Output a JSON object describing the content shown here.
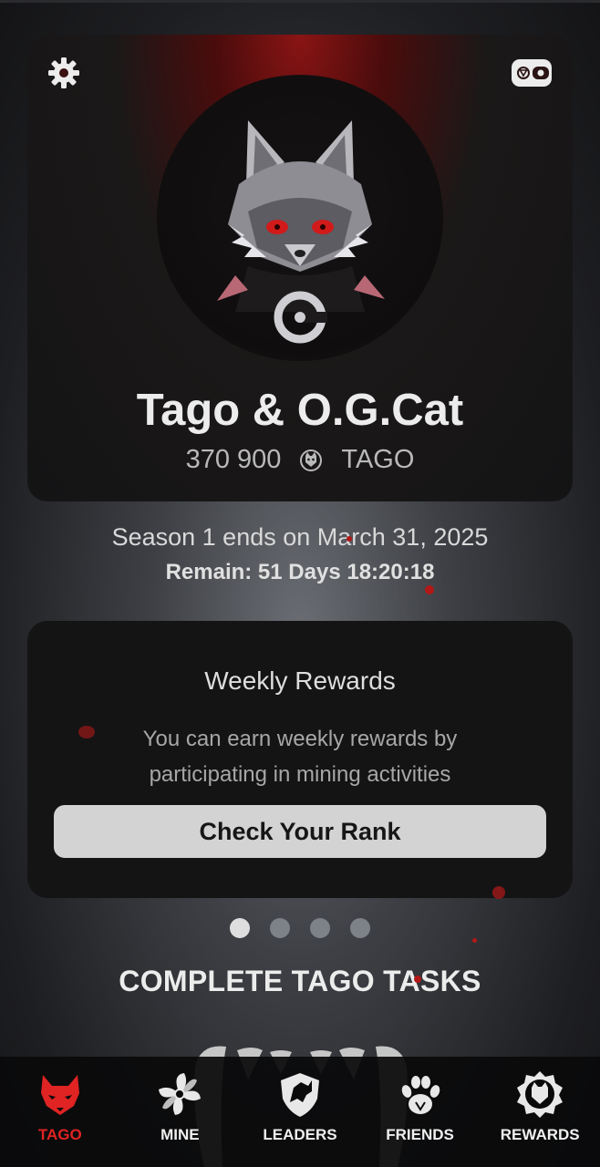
{
  "hero": {
    "title": "Tago & O.G.Cat",
    "balance": "370 900",
    "currency": "TAGO",
    "icons": [
      "gear-icon",
      "wallet-icon",
      "tago-coin-icon"
    ]
  },
  "season": {
    "ends_text": "Season 1 ends on March 31, 2025",
    "remain_text": "Remain: 51 Days 18:20:18"
  },
  "weekly": {
    "title": "Weekly Rewards",
    "description": "You can earn weekly rewards by participating in mining activities",
    "button_label": "Check Your Rank"
  },
  "carousel": {
    "pages": 4,
    "active_index": 0
  },
  "tasks_heading": "COMPLETE TAGO TASKS",
  "nav": {
    "items": [
      {
        "label": "TAGO",
        "icon": "wolf-icon",
        "active": true
      },
      {
        "label": "MINE",
        "icon": "pinwheel-icon",
        "active": false
      },
      {
        "label": "LEADERS",
        "icon": "wolf-shield-icon",
        "active": false
      },
      {
        "label": "FRIENDS",
        "icon": "paw-icon",
        "active": false
      },
      {
        "label": "REWARDS",
        "icon": "badge-icon",
        "active": false
      }
    ]
  },
  "colors": {
    "accent_red": "#e02323",
    "card_bg": "#141415",
    "button_bg": "#d3d3d3",
    "nav_bg": "#0a0a0b"
  }
}
